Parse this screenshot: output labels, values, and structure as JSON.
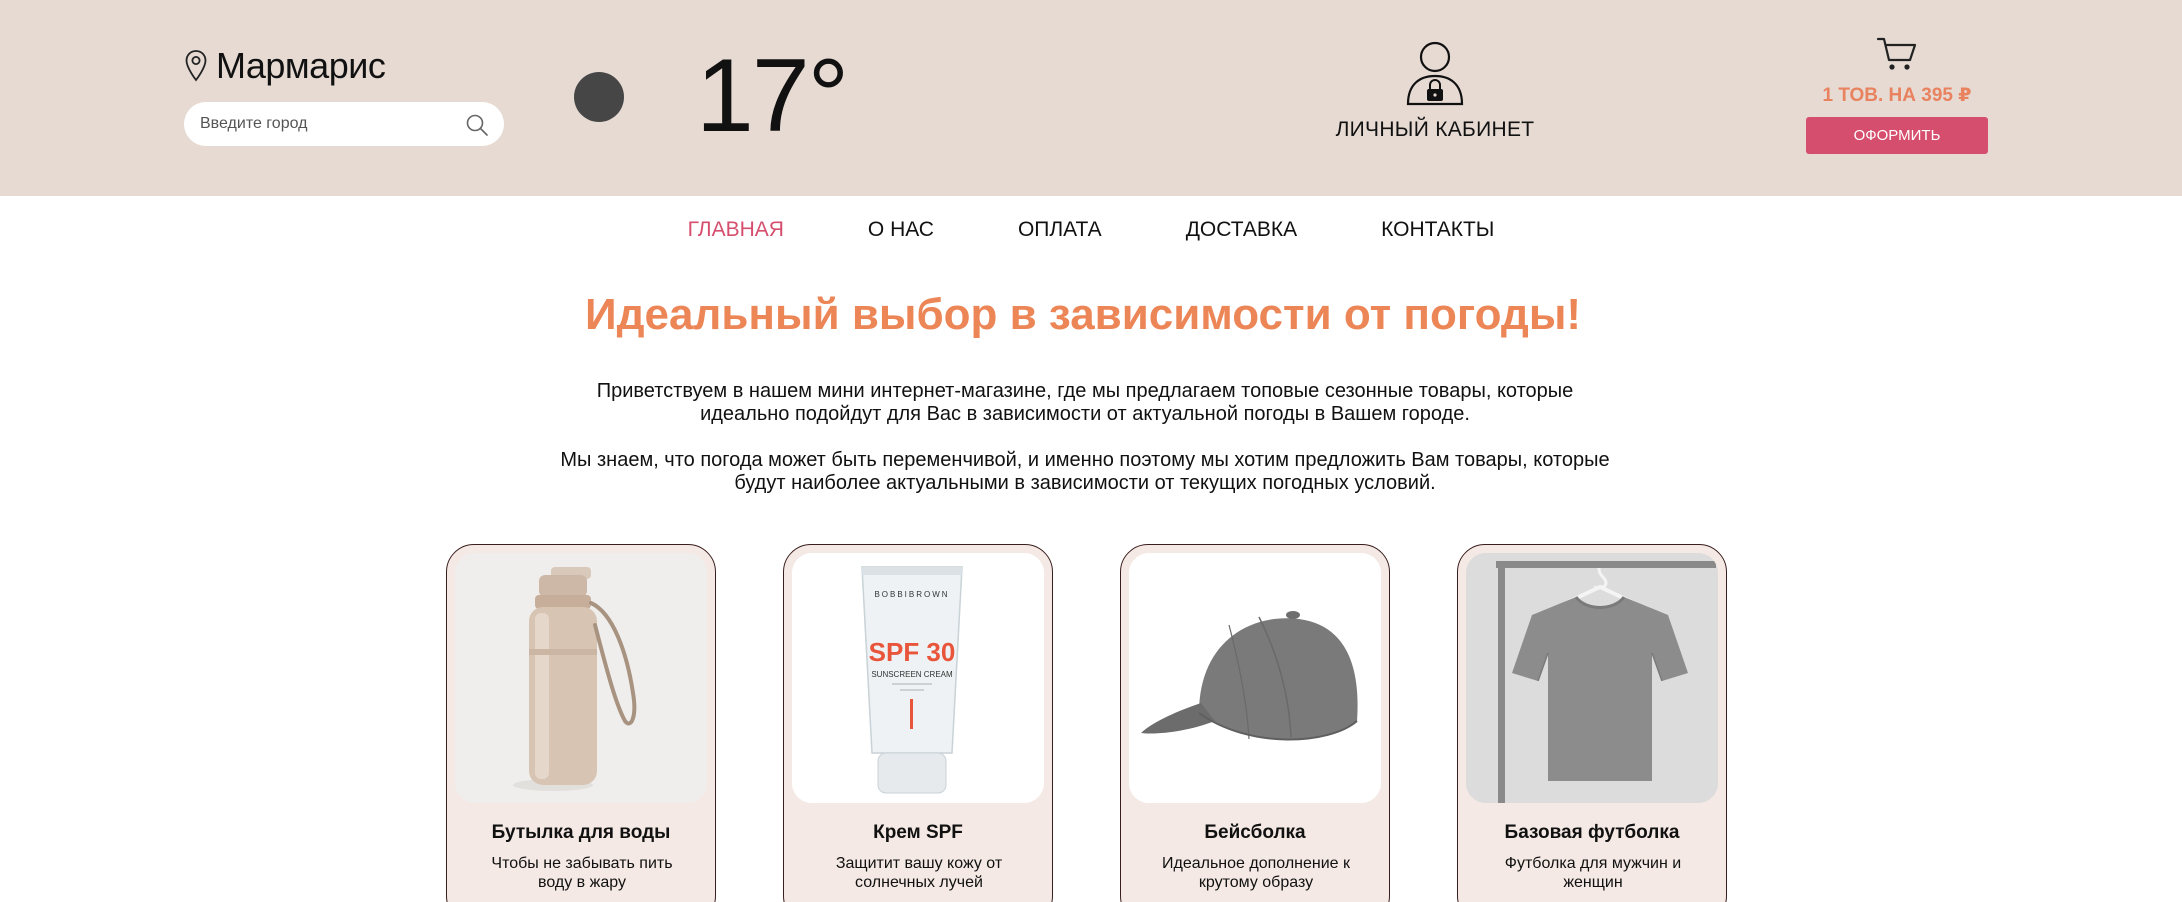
{
  "header": {
    "city": "Мармарис",
    "search_placeholder": "Введите город",
    "temperature": "17°",
    "account_label": "ЛИЧНЫЙ КАБИНЕТ",
    "cart_summary": "1 ТОВ. НА 395 ₽",
    "checkout_label": "ОФОРМИТЬ"
  },
  "nav": {
    "items": [
      "ГЛАВНАЯ",
      "О НАС",
      "ОПЛАТА",
      "ДОСТАВКА",
      "КОНТАКТЫ"
    ],
    "active": "ГЛАВНАЯ"
  },
  "hero": {
    "title": "Идеальный выбор в зависимости от погоды!",
    "paragraphs": [
      "Приветствуем в нашем мини интернет-магазине, где мы предлагаем топовые сезонные товары, которые идеально подойдут для Вас в зависимости от актуальной погоды в Вашем городе.",
      "Мы знаем, что погода может быть переменчивой, и именно поэтому мы хотим предложить Вам товары, которые будут наиболее актуальными в зависимости от текущих погодных условий."
    ]
  },
  "products": [
    {
      "title": "Бутылка для воды",
      "desc": "Чтобы не забывать пить воду в жару",
      "icon": "water-bottle"
    },
    {
      "title": "Крем SPF",
      "desc": "Защитит вашу кожу от солнечных лучей",
      "icon": "sunscreen-tube",
      "tube_text": "SPF 30",
      "tube_brand": "BOBBIBROWN",
      "tube_caption": "SUNSCREEN CREAM"
    },
    {
      "title": "Бейсболка",
      "desc": "Идеальное дополнение к крутому образу",
      "icon": "baseball-cap"
    },
    {
      "title": "Базовая футболка",
      "desc": "Футболка для мужчин и женщин",
      "icon": "t-shirt"
    }
  ],
  "colors": {
    "header_bg": "#e6dad3",
    "accent_orange": "#ec8657",
    "accent_pink": "#d64e6d",
    "card_bg": "#f4e9e4"
  }
}
